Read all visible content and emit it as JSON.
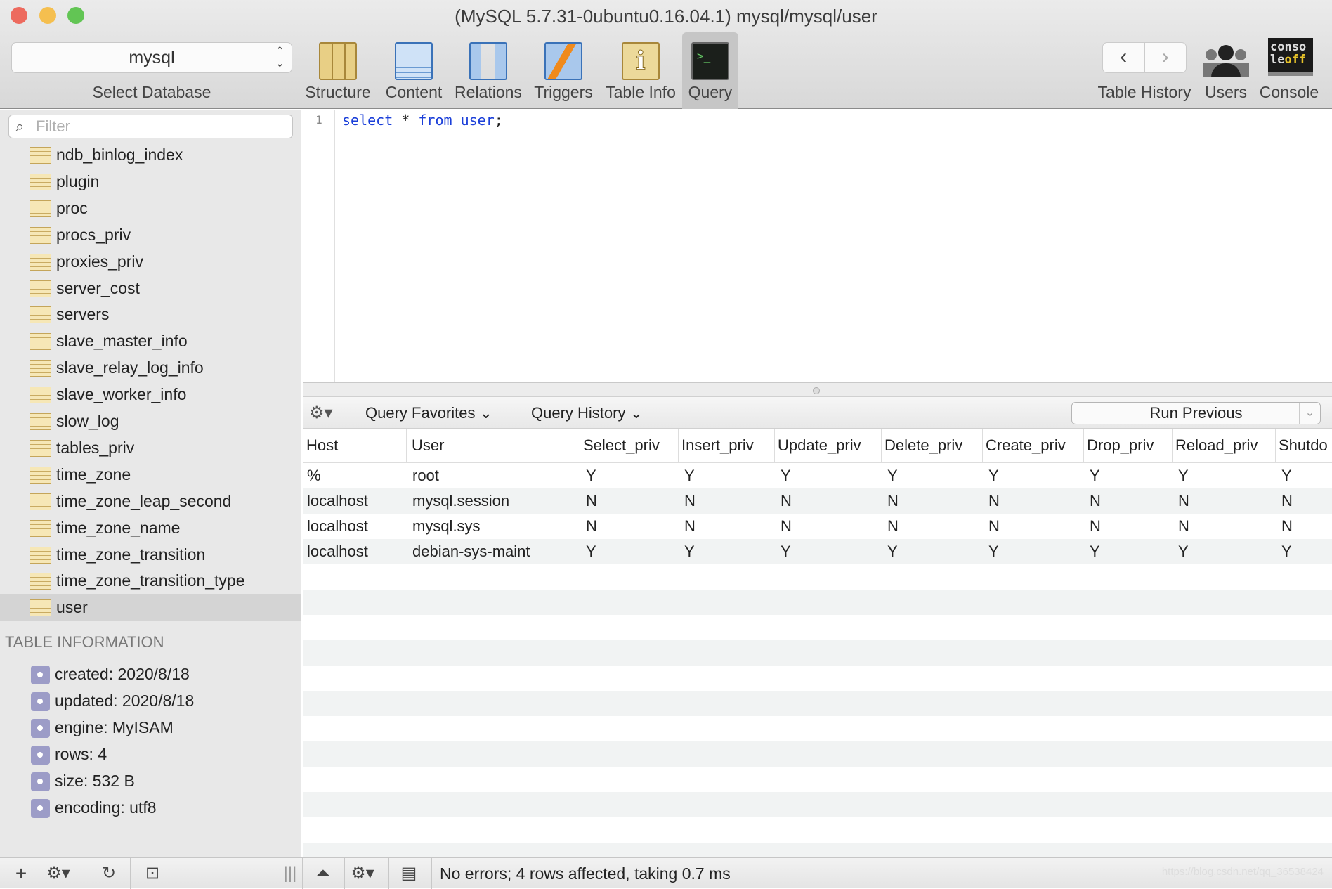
{
  "window": {
    "title": "(MySQL 5.7.31-0ubuntu0.16.04.1) mysql/mysql/user"
  },
  "toolbar": {
    "database": "mysql",
    "database_label": "Select Database",
    "items": [
      {
        "label": "Structure",
        "icon": "structure-icon"
      },
      {
        "label": "Content",
        "icon": "content-icon"
      },
      {
        "label": "Relations",
        "icon": "relations-icon"
      },
      {
        "label": "Triggers",
        "icon": "triggers-icon"
      },
      {
        "label": "Table Info",
        "icon": "table-info-icon"
      },
      {
        "label": "Query",
        "icon": "query-icon",
        "active": true
      }
    ],
    "table_history_label": "Table History",
    "users_label": "Users",
    "console_label": "Console",
    "console_icon_text": "conso le off"
  },
  "sidebar": {
    "filter_placeholder": "Filter",
    "tables": [
      "ndb_binlog_index",
      "plugin",
      "proc",
      "procs_priv",
      "proxies_priv",
      "server_cost",
      "servers",
      "slave_master_info",
      "slave_relay_log_info",
      "slave_worker_info",
      "slow_log",
      "tables_priv",
      "time_zone",
      "time_zone_leap_second",
      "time_zone_name",
      "time_zone_transition",
      "time_zone_transition_type",
      "user"
    ],
    "selected": "user",
    "info_header": "TABLE INFORMATION",
    "info": [
      "created: 2020/8/18",
      "updated: 2020/8/18",
      "engine: MyISAM",
      "rows: 4",
      "size: 532 B",
      "encoding: utf8"
    ]
  },
  "editor": {
    "line_number": "1",
    "kw1": "select",
    "mid": " * ",
    "kw2": "from",
    "kw3": "user",
    "end": ";"
  },
  "query_bar": {
    "favorites": "Query Favorites",
    "history": "Query History",
    "run_previous": "Run Previous"
  },
  "results": {
    "columns": [
      "Host",
      "User",
      "Select_priv",
      "Insert_priv",
      "Update_priv",
      "Delete_priv",
      "Create_priv",
      "Drop_priv",
      "Reload_priv",
      "Shutdo"
    ],
    "rows": [
      [
        "%",
        "root",
        "Y",
        "Y",
        "Y",
        "Y",
        "Y",
        "Y",
        "Y",
        "Y"
      ],
      [
        "localhost",
        "mysql.session",
        "N",
        "N",
        "N",
        "N",
        "N",
        "N",
        "N",
        "N"
      ],
      [
        "localhost",
        "mysql.sys",
        "N",
        "N",
        "N",
        "N",
        "N",
        "N",
        "N",
        "N"
      ],
      [
        "localhost",
        "debian-sys-maint",
        "Y",
        "Y",
        "Y",
        "Y",
        "Y",
        "Y",
        "Y",
        "Y"
      ]
    ]
  },
  "status": {
    "message": "No errors; 4 rows affected, taking 0.7 ms"
  },
  "watermark": "https://blog.csdn.net/qq_36538424"
}
